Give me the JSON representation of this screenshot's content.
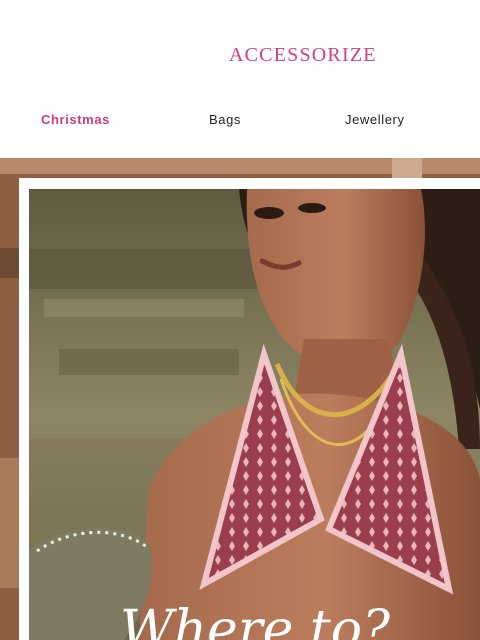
{
  "brand": {
    "logo_text": "ACCESSORIZE"
  },
  "nav": {
    "items": [
      {
        "label": "Christmas",
        "active": true
      },
      {
        "label": "Bags",
        "active": false
      },
      {
        "label": "Jewellery",
        "active": false
      }
    ]
  },
  "hero": {
    "headline_partial": "Where to?",
    "image_description_icon": "model-wearing-gold-chain-necklace-photo"
  },
  "colors": {
    "brand_pink": "#d23f7e",
    "nav_active": "#cf3d7a",
    "nav_text": "#222222"
  }
}
